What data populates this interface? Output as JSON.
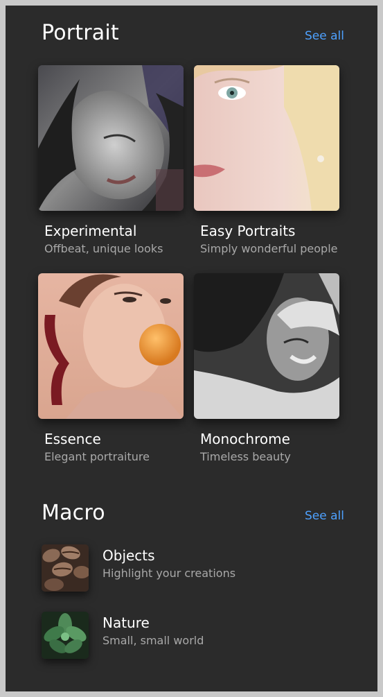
{
  "portrait": {
    "title": "Portrait",
    "see_all": "See all",
    "cards": [
      {
        "title": "Experimental",
        "subtitle": "Offbeat, unique looks",
        "icon": "experimental-portrait-photo"
      },
      {
        "title": "Easy Portraits",
        "subtitle": "Simply wonderful people",
        "icon": "easy-portraits-photo"
      },
      {
        "title": "Essence",
        "subtitle": "Elegant portraiture",
        "icon": "essence-portrait-photo"
      },
      {
        "title": "Monochrome",
        "subtitle": "Timeless beauty",
        "icon": "monochrome-portrait-photo"
      }
    ]
  },
  "macro": {
    "title": "Macro",
    "see_all": "See all",
    "items": [
      {
        "title": "Objects",
        "subtitle": "Highlight your creations",
        "icon": "coffee-beans-photo"
      },
      {
        "title": "Nature",
        "subtitle": "Small, small world",
        "icon": "succulent-photo"
      }
    ]
  },
  "colors": {
    "background": "#2b2b2b",
    "accent": "#4ea1ff",
    "text_primary": "#ffffff",
    "text_secondary": "#a9a9a9"
  }
}
